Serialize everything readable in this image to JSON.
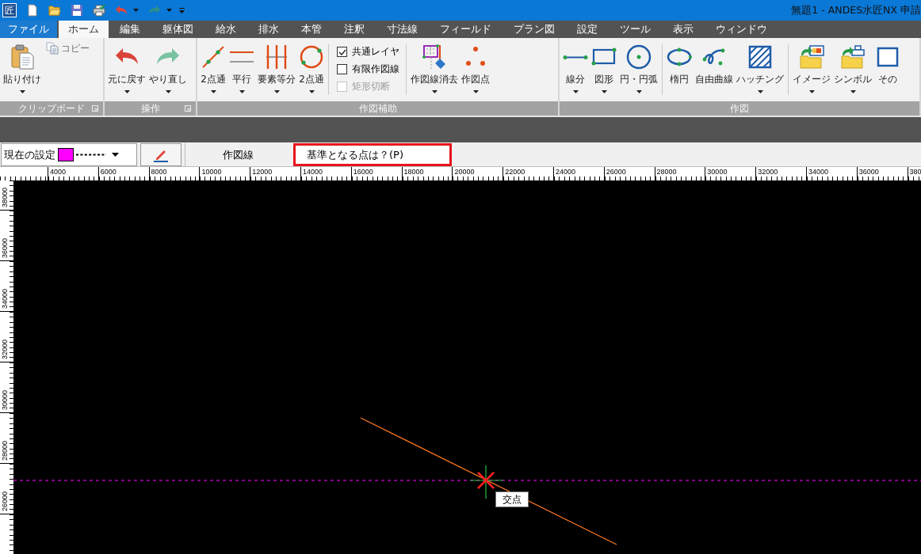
{
  "title_bar": {
    "app_icon": "匠",
    "title": "無題1 - ANDES水匠NX 申請"
  },
  "menu_tabs": [
    {
      "label": "ファイル",
      "kind": "file",
      "selected": false
    },
    {
      "label": "ホーム",
      "kind": "tab",
      "selected": true
    },
    {
      "label": "編集",
      "kind": "tab",
      "selected": false
    },
    {
      "label": "躯体図",
      "kind": "tab",
      "selected": false
    },
    {
      "label": "給水",
      "kind": "tab",
      "selected": false
    },
    {
      "label": "排水",
      "kind": "tab",
      "selected": false
    },
    {
      "label": "本管",
      "kind": "tab",
      "selected": false
    },
    {
      "label": "注釈",
      "kind": "tab",
      "selected": false
    },
    {
      "label": "寸法線",
      "kind": "tab",
      "selected": false
    },
    {
      "label": "フィールド",
      "kind": "tab",
      "selected": false
    },
    {
      "label": "プラン図",
      "kind": "tab",
      "selected": false
    },
    {
      "label": "設定",
      "kind": "tab",
      "selected": false
    },
    {
      "label": "ツール",
      "kind": "tab",
      "selected": false
    },
    {
      "label": "表示",
      "kind": "tab",
      "selected": false
    },
    {
      "label": "ウィンドウ",
      "kind": "tab",
      "selected": false
    }
  ],
  "ribbon": {
    "groups": [
      {
        "label": "クリップボード",
        "launcher": true,
        "sections": [
          {
            "kind": "buttons",
            "items": [
              {
                "kind": "large",
                "label": "貼り付け",
                "dropdown": true,
                "disabled": false
              },
              {
                "kind": "small",
                "label": "コピー",
                "dropdown": false,
                "disabled": true
              }
            ]
          }
        ]
      },
      {
        "label": "操作",
        "launcher": true,
        "sections": [
          {
            "kind": "buttons",
            "items": [
              {
                "kind": "large",
                "label": "元に戻す",
                "dropdown": true,
                "disabled": false
              },
              {
                "kind": "large",
                "label": "やり直し",
                "dropdown": true,
                "disabled": false
              }
            ]
          }
        ]
      },
      {
        "label": "作図補助",
        "launcher": false,
        "sections": [
          {
            "kind": "buttons",
            "items": [
              {
                "kind": "large",
                "label": "2点通",
                "dropdown": true,
                "disabled": false
              },
              {
                "kind": "large",
                "label": "平行",
                "dropdown": true,
                "disabled": false
              },
              {
                "kind": "large",
                "label": "要素等分",
                "dropdown": true,
                "disabled": false
              },
              {
                "kind": "large",
                "label": "2点通",
                "dropdown": true,
                "disabled": false
              }
            ]
          },
          {
            "kind": "checklist",
            "items": [
              {
                "kind": "checkbox",
                "label": "共通レイヤ",
                "checked": true,
                "disabled": false
              },
              {
                "kind": "checkbox",
                "label": "有限作図線",
                "checked": false,
                "disabled": false
              },
              {
                "kind": "checkbox",
                "label": "矩形切断",
                "checked": false,
                "disabled": true
              }
            ]
          },
          {
            "kind": "buttons",
            "items": [
              {
                "kind": "large",
                "label": "作図線消去",
                "dropdown": true,
                "disabled": false
              },
              {
                "kind": "large",
                "label": "作図点",
                "dropdown": true,
                "disabled": false
              }
            ]
          }
        ]
      },
      {
        "label": "作図",
        "launcher": false,
        "sections": [
          {
            "kind": "buttons",
            "items": [
              {
                "kind": "large",
                "label": "線分",
                "dropdown": true,
                "disabled": false
              },
              {
                "kind": "large",
                "label": "図形",
                "dropdown": true,
                "disabled": false
              },
              {
                "kind": "large",
                "label": "円・円弧",
                "dropdown": true,
                "disabled": false
              }
            ]
          },
          {
            "kind": "buttons",
            "items": [
              {
                "kind": "large",
                "label": "楕円",
                "dropdown": false,
                "disabled": false
              },
              {
                "kind": "large",
                "label": "自由曲線",
                "dropdown": false,
                "disabled": false
              },
              {
                "kind": "large",
                "label": "ハッチング",
                "dropdown": true,
                "disabled": false
              }
            ]
          },
          {
            "kind": "buttons",
            "items": [
              {
                "kind": "large",
                "label": "イメージ",
                "dropdown": true,
                "disabled": false
              },
              {
                "kind": "large",
                "label": "シンボル",
                "dropdown": true,
                "disabled": false
              },
              {
                "kind": "large",
                "label": "その",
                "dropdown": false,
                "disabled": false
              }
            ]
          }
        ]
      }
    ]
  },
  "command_bar": {
    "current_setting": "現在の設定",
    "mode": "作図線",
    "prompt": "基準となる点は？(P)"
  },
  "horizontal_ruler": {
    "labels": [
      "4000",
      "6000",
      "8000",
      "10000",
      "12000",
      "14000",
      "16000",
      "18000",
      "20000",
      "22000",
      "24000",
      "26000",
      "28000",
      "30000",
      "32000",
      "34000",
      "36000",
      "380"
    ]
  },
  "vertical_ruler": {
    "labels": [
      "38000",
      "36000",
      "34000",
      "32000",
      "30000",
      "28000",
      "26000"
    ]
  },
  "canvas": {
    "tooltip": "交点"
  }
}
